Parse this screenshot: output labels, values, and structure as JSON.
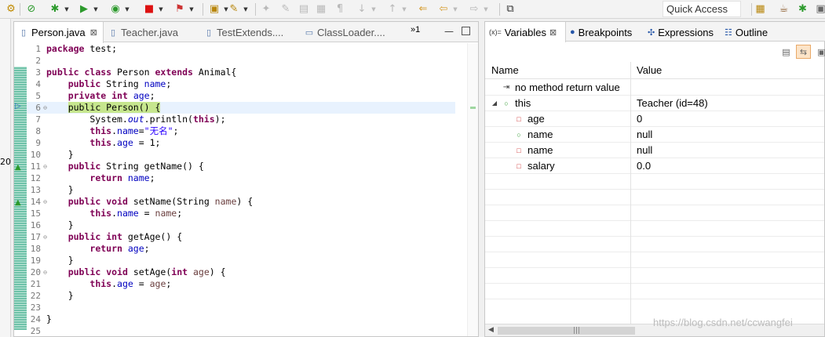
{
  "toolbar": {
    "buttons": [
      {
        "name": "debug-perspective-icon",
        "glyph": "⚙"
      },
      {
        "name": "skip-breakpoints-icon",
        "glyph": "⊘"
      },
      {
        "name": "debug-icon",
        "glyph": "✱"
      },
      {
        "name": "run-icon",
        "glyph": "▶"
      },
      {
        "name": "coverage-icon",
        "glyph": "◉"
      },
      {
        "name": "stop-icon",
        "glyph": "■"
      },
      {
        "name": "external-tools-icon",
        "glyph": "⚑"
      },
      {
        "name": "open-folder-icon",
        "glyph": "▣"
      },
      {
        "name": "wand-icon",
        "glyph": "✎"
      }
    ],
    "quick_access_placeholder": "Quick Access"
  },
  "left_stub": {
    "mark": "20"
  },
  "editor": {
    "tabs": [
      {
        "label": "Person.java",
        "active": true
      },
      {
        "label": "Teacher.java",
        "active": false
      },
      {
        "label": "TestExtends....",
        "active": false
      },
      {
        "label": "ClassLoader....",
        "active": false
      }
    ],
    "overflow_label": "»1",
    "current_line": 6,
    "lines": [
      {
        "n": "1",
        "tokens": [
          {
            "t": "package",
            "c": "k"
          },
          {
            "t": " test;"
          }
        ]
      },
      {
        "n": "2",
        "tokens": []
      },
      {
        "n": "3",
        "tokens": [
          {
            "t": "public",
            "c": "k"
          },
          {
            "t": " "
          },
          {
            "t": "class",
            "c": "k"
          },
          {
            "t": " Person "
          },
          {
            "t": "extends",
            "c": "k"
          },
          {
            "t": " Animal{"
          }
        ]
      },
      {
        "n": "4",
        "tokens": [
          {
            "t": "    "
          },
          {
            "t": "public",
            "c": "k"
          },
          {
            "t": " String "
          },
          {
            "t": "name",
            "c": "f"
          },
          {
            "t": ";"
          }
        ]
      },
      {
        "n": "5",
        "tokens": [
          {
            "t": "    "
          },
          {
            "t": "private",
            "c": "k"
          },
          {
            "t": " "
          },
          {
            "t": "int",
            "c": "k"
          },
          {
            "t": " "
          },
          {
            "t": "age",
            "c": "f"
          },
          {
            "t": ";"
          }
        ]
      },
      {
        "n": "6",
        "fold": "⊖",
        "tokens": [
          {
            "t": "    "
          },
          {
            "t": "public Person() {",
            "c": "hl"
          }
        ]
      },
      {
        "n": "7",
        "tokens": [
          {
            "t": "        System."
          },
          {
            "t": "out",
            "c": "fi"
          },
          {
            "t": ".println("
          },
          {
            "t": "this",
            "c": "k"
          },
          {
            "t": ");"
          }
        ]
      },
      {
        "n": "8",
        "tokens": [
          {
            "t": "        "
          },
          {
            "t": "this",
            "c": "k"
          },
          {
            "t": "."
          },
          {
            "t": "name",
            "c": "f"
          },
          {
            "t": "="
          },
          {
            "t": "\"无名\"",
            "c": "s"
          },
          {
            "t": ";"
          }
        ]
      },
      {
        "n": "9",
        "tokens": [
          {
            "t": "        "
          },
          {
            "t": "this",
            "c": "k"
          },
          {
            "t": "."
          },
          {
            "t": "age",
            "c": "f"
          },
          {
            "t": " = 1;"
          }
        ]
      },
      {
        "n": "10",
        "tokens": [
          {
            "t": "    }"
          }
        ]
      },
      {
        "n": "11",
        "fold": "⊖",
        "tokens": [
          {
            "t": "    "
          },
          {
            "t": "public",
            "c": "k"
          },
          {
            "t": " String getName() {"
          }
        ]
      },
      {
        "n": "12",
        "tokens": [
          {
            "t": "        "
          },
          {
            "t": "return",
            "c": "k"
          },
          {
            "t": " "
          },
          {
            "t": "name",
            "c": "f"
          },
          {
            "t": ";"
          }
        ]
      },
      {
        "n": "13",
        "tokens": [
          {
            "t": "    }"
          }
        ]
      },
      {
        "n": "14",
        "fold": "⊖",
        "tokens": [
          {
            "t": "    "
          },
          {
            "t": "public",
            "c": "k"
          },
          {
            "t": " "
          },
          {
            "t": "void",
            "c": "k"
          },
          {
            "t": " setName(String "
          },
          {
            "t": "name",
            "c": "p"
          },
          {
            "t": ") {"
          }
        ]
      },
      {
        "n": "15",
        "tokens": [
          {
            "t": "        "
          },
          {
            "t": "this",
            "c": "k"
          },
          {
            "t": "."
          },
          {
            "t": "name",
            "c": "f"
          },
          {
            "t": " = "
          },
          {
            "t": "name",
            "c": "p"
          },
          {
            "t": ";"
          }
        ]
      },
      {
        "n": "16",
        "tokens": [
          {
            "t": "    }"
          }
        ]
      },
      {
        "n": "17",
        "fold": "⊖",
        "tokens": [
          {
            "t": "    "
          },
          {
            "t": "public",
            "c": "k"
          },
          {
            "t": " "
          },
          {
            "t": "int",
            "c": "k"
          },
          {
            "t": " getAge() {"
          }
        ]
      },
      {
        "n": "18",
        "tokens": [
          {
            "t": "        "
          },
          {
            "t": "return",
            "c": "k"
          },
          {
            "t": " "
          },
          {
            "t": "age",
            "c": "f"
          },
          {
            "t": ";"
          }
        ]
      },
      {
        "n": "19",
        "tokens": [
          {
            "t": "    }"
          }
        ]
      },
      {
        "n": "20",
        "fold": "⊖",
        "tokens": [
          {
            "t": "    "
          },
          {
            "t": "public",
            "c": "k"
          },
          {
            "t": " "
          },
          {
            "t": "void",
            "c": "k"
          },
          {
            "t": " setAge("
          },
          {
            "t": "int",
            "c": "k"
          },
          {
            "t": " "
          },
          {
            "t": "age",
            "c": "p"
          },
          {
            "t": ") {"
          }
        ]
      },
      {
        "n": "21",
        "tokens": [
          {
            "t": "        "
          },
          {
            "t": "this",
            "c": "k"
          },
          {
            "t": "."
          },
          {
            "t": "age",
            "c": "f"
          },
          {
            "t": " = "
          },
          {
            "t": "age",
            "c": "p"
          },
          {
            "t": ";"
          }
        ]
      },
      {
        "n": "22",
        "tokens": [
          {
            "t": "    }"
          }
        ]
      },
      {
        "n": "23",
        "tokens": []
      },
      {
        "n": "24",
        "tokens": [
          {
            "t": "}"
          }
        ]
      },
      {
        "n": "25",
        "tokens": []
      }
    ]
  },
  "panel": {
    "tabs": [
      {
        "label": "Variables",
        "icon": "(x)=",
        "icon_name": "variables-icon",
        "active": true
      },
      {
        "label": "Breakpoints",
        "icon": "●",
        "icon_name": "breakpoints-icon",
        "active": false
      },
      {
        "label": "Expressions",
        "icon": "✣",
        "icon_name": "expressions-icon",
        "active": false
      },
      {
        "label": "Outline",
        "icon": "☷",
        "icon_name": "outline-icon",
        "active": false
      }
    ],
    "columns": {
      "name": "Name",
      "value": "Value"
    },
    "rows": [
      {
        "indent": 0,
        "twisty": "",
        "icon": "⇥",
        "icon_name": "method-return-icon",
        "icon_class": "ret",
        "name": "no method return value",
        "value": ""
      },
      {
        "indent": 0,
        "twisty": "◢",
        "icon": "○",
        "icon_name": "public-field-icon",
        "icon_class": "green",
        "name": "this",
        "value": "Teacher  (id=48)"
      },
      {
        "indent": 1,
        "twisty": "",
        "icon": "□",
        "icon_name": "private-field-icon",
        "icon_class": "red",
        "name": "age",
        "value": "0"
      },
      {
        "indent": 1,
        "twisty": "",
        "icon": "○",
        "icon_name": "public-field-icon",
        "icon_class": "green",
        "name": "name",
        "value": "null"
      },
      {
        "indent": 1,
        "twisty": "",
        "icon": "□",
        "icon_name": "private-field-icon",
        "icon_class": "red",
        "name": "name",
        "value": "null"
      },
      {
        "indent": 1,
        "twisty": "",
        "icon": "□",
        "icon_name": "private-field-icon",
        "icon_class": "red",
        "name": "salary",
        "value": "0.0"
      }
    ],
    "empty_rows": 8
  },
  "watermark": "https://blog.csdn.net/ccwangfei"
}
